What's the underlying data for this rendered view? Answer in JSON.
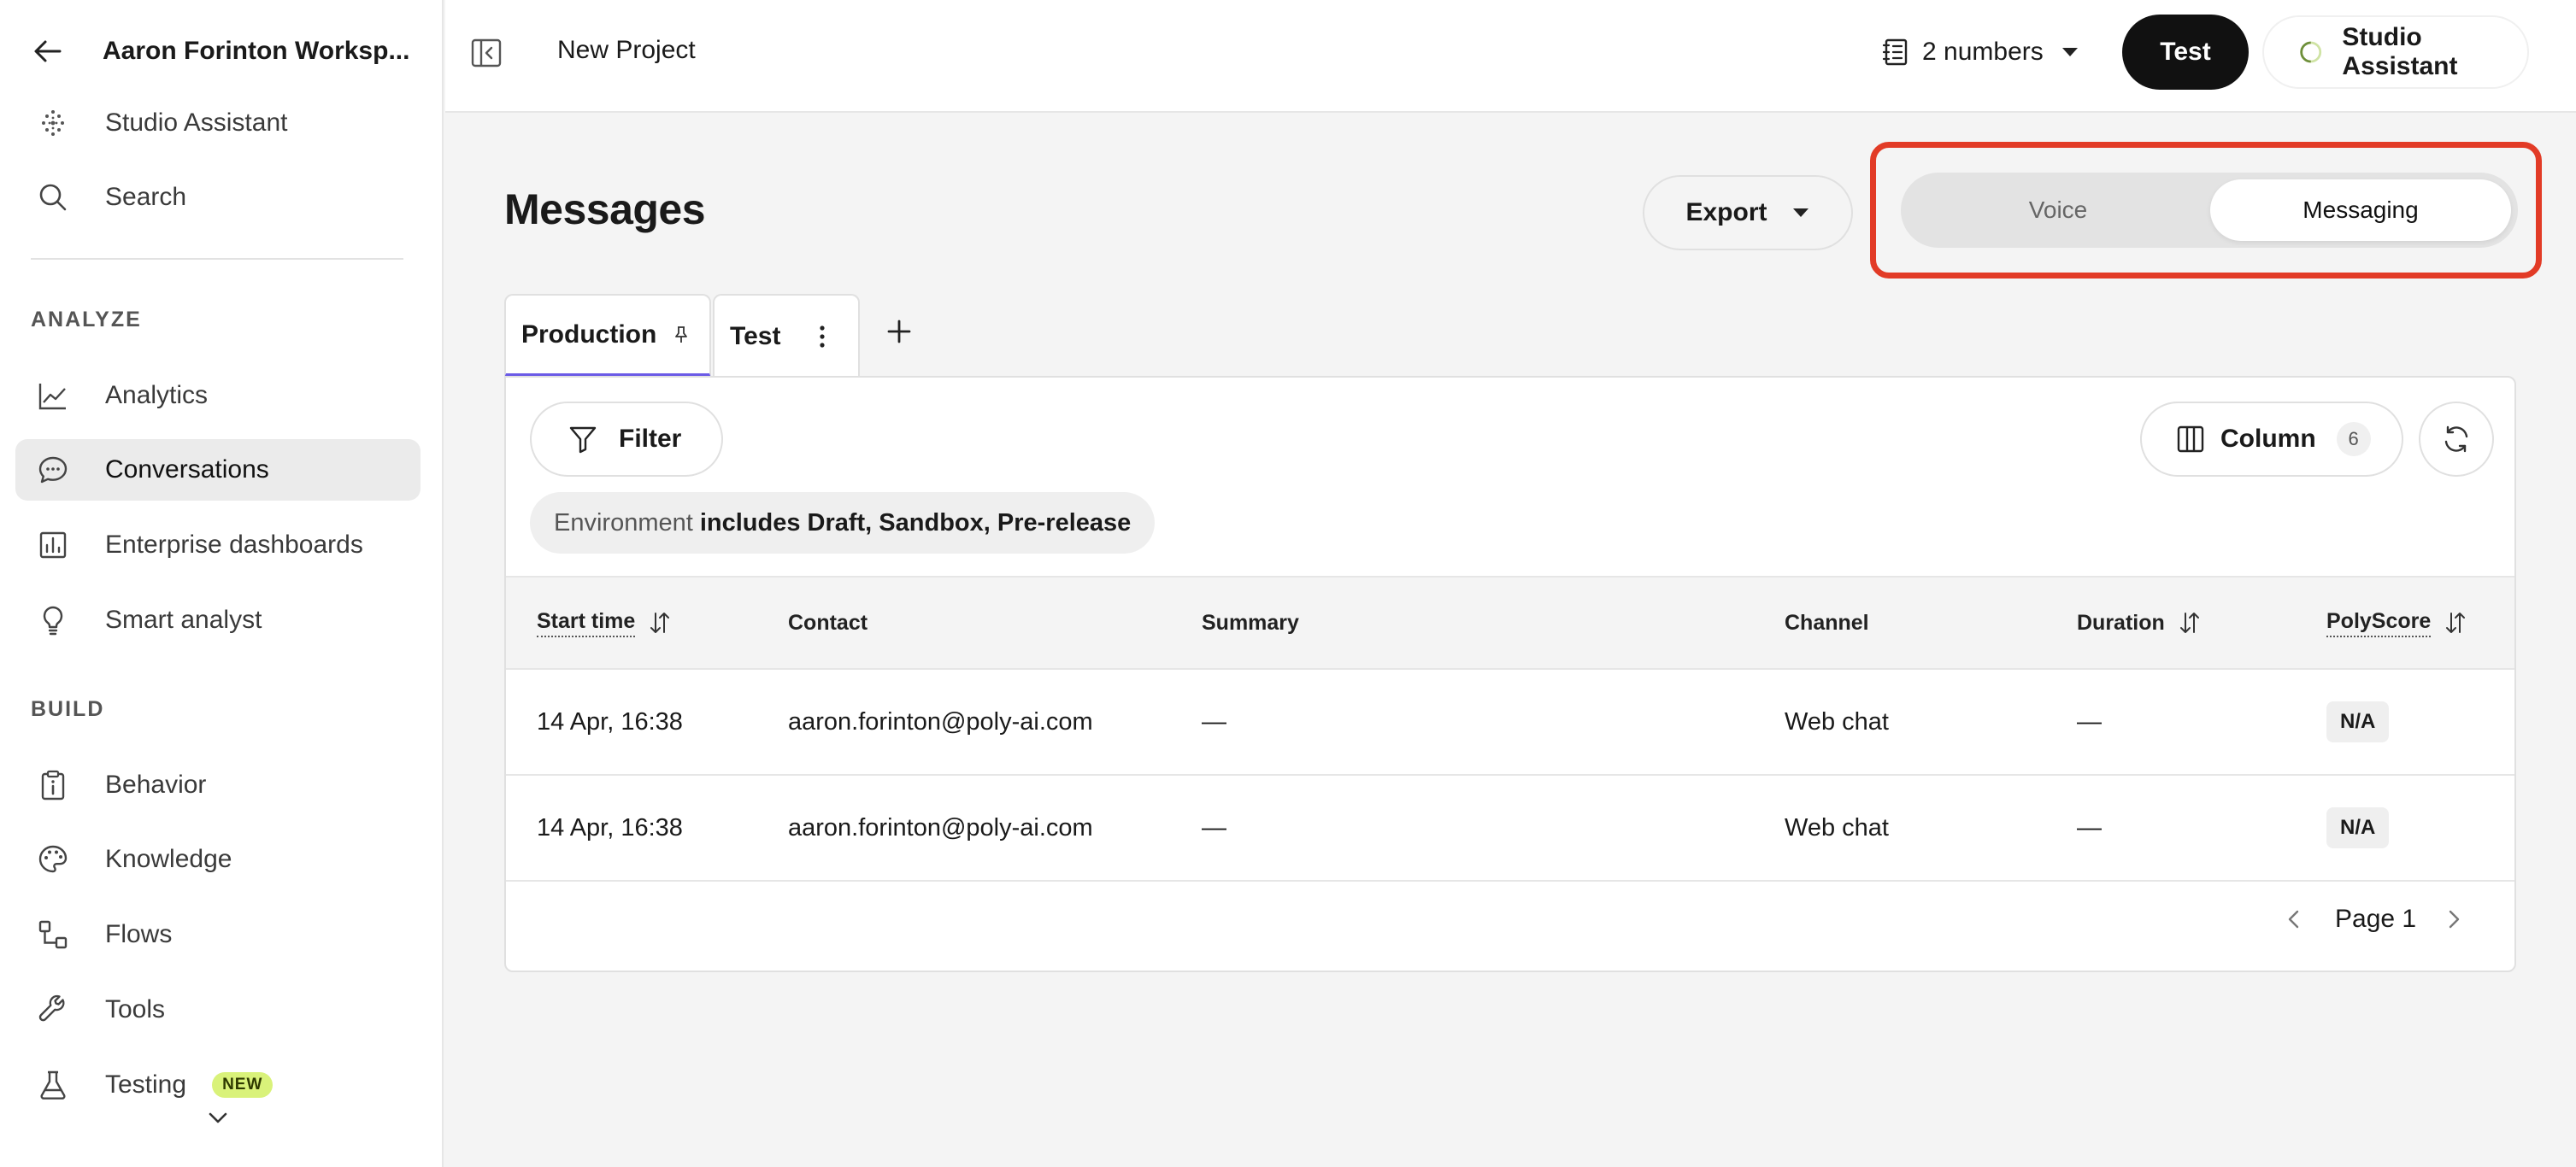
{
  "sidebar": {
    "workspace": "Aaron Forinton Worksp...",
    "top_items": [
      {
        "label": "Studio Assistant"
      },
      {
        "label": "Search"
      }
    ],
    "section_analyze": "ANALYZE",
    "analyze_items": [
      {
        "label": "Analytics"
      },
      {
        "label": "Conversations"
      },
      {
        "label": "Enterprise dashboards"
      },
      {
        "label": "Smart analyst"
      }
    ],
    "section_build": "BUILD",
    "build_items": [
      {
        "label": "Behavior"
      },
      {
        "label": "Knowledge"
      },
      {
        "label": "Flows"
      },
      {
        "label": "Tools"
      },
      {
        "label": "Testing",
        "badge": "NEW"
      }
    ]
  },
  "topbar": {
    "project": "New Project",
    "numbers": "2 numbers",
    "test": "Test",
    "assistant": "Studio Assistant"
  },
  "page": {
    "title": "Messages",
    "export": "Export",
    "mode_toggle": {
      "voice": "Voice",
      "messaging": "Messaging",
      "selected": "Messaging"
    },
    "tabs": [
      {
        "label": "Production",
        "pinned": true
      },
      {
        "label": "Test"
      }
    ],
    "filter": "Filter",
    "column": "Column",
    "column_count": "6",
    "env_chip": {
      "key": "Environment",
      "value": "includes Draft, Sandbox, Pre-release"
    },
    "table": {
      "headers": [
        "Start time",
        "Contact",
        "Summary",
        "Channel",
        "Duration",
        "PolyScore"
      ],
      "rows": [
        [
          "14 Apr, 16:38",
          "aaron.forinton@poly-ai.com",
          "—",
          "Web chat",
          "—",
          "N/A"
        ],
        [
          "14 Apr, 16:38",
          "aaron.forinton@poly-ai.com",
          "—",
          "Web chat",
          "—",
          "N/A"
        ]
      ]
    },
    "pager": "Page 1"
  },
  "colors": {
    "highlight": "#e23b26",
    "tab_underline": "#6b5be6",
    "new_badge": "#d9f27a"
  }
}
